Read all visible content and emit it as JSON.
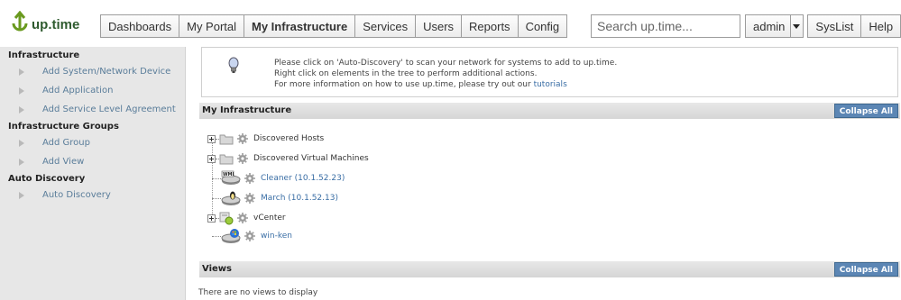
{
  "app": {
    "logo_text": "up.time"
  },
  "nav": {
    "items": [
      "Dashboards",
      "My Portal",
      "My Infrastructure",
      "Services",
      "Users",
      "Reports",
      "Config"
    ],
    "active": "My Infrastructure",
    "search_placeholder": "Search up.time...",
    "user": "admin",
    "syslist": "SysList",
    "help": "Help"
  },
  "sidebar": {
    "sections": [
      {
        "title": "Infrastructure",
        "items": [
          "Add System/Network Device",
          "Add Application",
          "Add Service Level Agreement"
        ]
      },
      {
        "title": "Infrastructure Groups",
        "items": [
          "Add Group",
          "Add View"
        ]
      },
      {
        "title": "Auto Discovery",
        "items": [
          "Auto Discovery"
        ]
      }
    ]
  },
  "info": {
    "line1": "Please click on 'Auto-Discovery' to scan your network for systems to add to up.time.",
    "line2": "Right click on elements in the tree to perform additional actions.",
    "line3_prefix": "For more information on how to use up.time, please try out our ",
    "line3_link": "tutorials"
  },
  "my_infrastructure": {
    "title": "My Infrastructure",
    "collapse_label": "Collapse All",
    "tree": [
      {
        "label": "Discovered Hosts",
        "type": "group",
        "expandable": true
      },
      {
        "label": "Discovered Virtual Machines",
        "type": "group",
        "expandable": true
      },
      {
        "label": "Cleaner (10.1.52.23)",
        "type": "system",
        "icon": "wmi-server-icon"
      },
      {
        "label": "March (10.1.52.13)",
        "type": "system",
        "icon": "linux-server-icon"
      },
      {
        "label": "vCenter",
        "type": "vcenter",
        "expandable": true
      },
      {
        "label": "win-ken",
        "type": "system",
        "icon": "windows-server-icon"
      }
    ]
  },
  "views": {
    "title": "Views",
    "collapse_label": "Collapse All",
    "empty_text": "There are no views to display"
  },
  "colors": {
    "accent": "#5c86b4",
    "link": "#3a6ea5",
    "sidebar_bg": "#e7e7e7"
  }
}
